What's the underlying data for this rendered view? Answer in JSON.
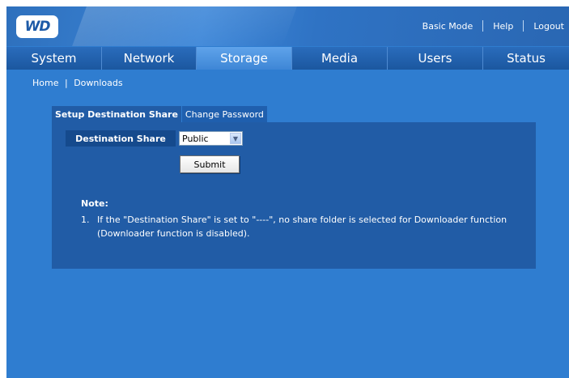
{
  "header": {
    "logo_text": "WD",
    "links": [
      "Basic Mode",
      "Help",
      "Logout"
    ]
  },
  "nav": {
    "tabs": [
      "System",
      "Network",
      "Storage",
      "Media",
      "Users",
      "Status"
    ],
    "active": "Storage"
  },
  "breadcrumb": {
    "home": "Home",
    "separator": "|",
    "current": "Downloads"
  },
  "subtabs": {
    "active": "Setup Destination Share",
    "other": "Change Password"
  },
  "form": {
    "label": "Destination Share",
    "selected": "Public",
    "submit": "Submit"
  },
  "note": {
    "title": "Note:",
    "items": [
      {
        "num": "1.",
        "text": "If the \"Destination Share\" is set to \"----\", no share folder is selected for Downloader function (Downloader function is disabled)."
      }
    ]
  },
  "colors": {
    "background": "#2f7dd0",
    "panel": "#215ca6",
    "nav": "#1f5fae",
    "active_tab": "#4e95e0"
  }
}
